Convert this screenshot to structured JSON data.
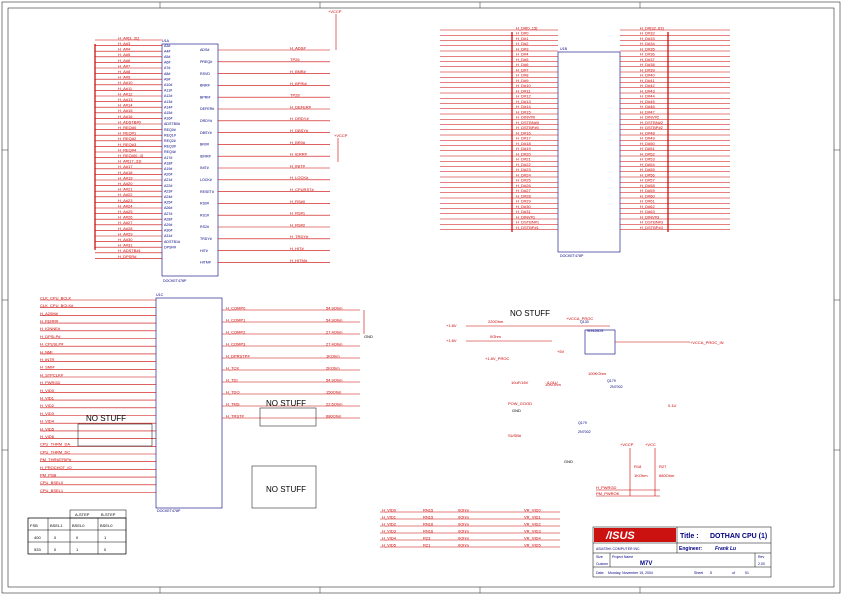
{
  "title_block": {
    "title_label": "Title :",
    "title": "DOTHAN CPU (1)",
    "company": "ASUSTeK COMPUTER INC.",
    "engineer_label": "Engineer:",
    "engineer": "Frank Lu",
    "project_label": "Project Name",
    "project": "M7V",
    "size_label": "Size",
    "size": "Custom",
    "rev_label": "Rev",
    "rev": "2.00",
    "date_label": "Date:",
    "date": "Monday, November 15, 2004",
    "sheet_label": "Sheet",
    "sheet": "5",
    "of_label": "of",
    "sheet_total": "51",
    "logo_text": "/ISUS"
  },
  "rails": {
    "vccp": "+VCCP",
    "vcca_proc": "+VCCA_PROC",
    "v1_8": "+1.8V",
    "v5": "+5V",
    "vcc": "+VCC",
    "gnd": "GND",
    "vcca_proc_in": "+VCCA_PROC_IN"
  },
  "annotations": {
    "no_stuff_1": "NO STUFF",
    "no_stuff_2": "NO STUFF",
    "no_stuff_3": "NO STUFF",
    "no_stuff_4": "NO STUFF"
  },
  "u1a": {
    "ref": "U1A",
    "part": "DOCKET478P",
    "left_nets": [
      "H_A#[3..31]",
      "H_A#3",
      "H_A#4",
      "H_A#5",
      "H_A#6",
      "H_A#7",
      "H_A#8",
      "H_A#9",
      "H_A#10",
      "H_A#11",
      "H_A#12",
      "H_A#13",
      "H_A#14",
      "H_A#15",
      "H_A#16",
      "H_ADSTB#0",
      "H_REQ#0",
      "H_REQ#1",
      "H_REQ#2",
      "H_REQ#3",
      "H_REQ#4",
      "H_REQ#[0..4]",
      "H_A#[17..31]",
      "H_A#17",
      "H_A#18",
      "H_A#19",
      "H_A#20",
      "H_A#21",
      "H_A#22",
      "H_A#23",
      "H_A#24",
      "H_A#25",
      "H_A#26",
      "H_A#27",
      "H_A#28",
      "H_A#29",
      "H_A#30",
      "H_A#31",
      "H_ADSTB#1",
      "H_DPSR#"
    ],
    "right_nets": [
      "H_ADS#",
      "TP26",
      "H_BNR#",
      "H_BPRI#",
      "TP28",
      "H_DEFER#",
      "H_DRDY#",
      "H_DBSY#",
      "H_BR0#",
      "H_IERR#",
      "H_INIT#",
      "H_LOCK#",
      "H_CPURST#",
      "H_RS#0",
      "H_RS#1",
      "H_RS#2",
      "H_TRDY#",
      "H_HIT#",
      "H_HITM#"
    ],
    "pin_labels": [
      "A3#",
      "A4#",
      "A5#",
      "A6#",
      "A7#",
      "A8#",
      "A9#",
      "A10#",
      "A11#",
      "A12#",
      "A13#",
      "A14#",
      "A15#",
      "A16#",
      "ADSTB0#",
      "REQ0#",
      "REQ1#",
      "REQ2#",
      "REQ3#",
      "REQ4#",
      "A17#",
      "A18#",
      "A19#",
      "A20#",
      "A21#",
      "A22#",
      "A23#",
      "A24#",
      "A25#",
      "A26#",
      "A27#",
      "A28#",
      "A29#",
      "A30#",
      "A31#",
      "ADSTB1#",
      "DPSR#"
    ],
    "right_pins": [
      "ADS#",
      "PREQ#",
      "RSVD",
      "BNR#",
      "BPRI#",
      "DEFER#",
      "DRDY#",
      "DBSY#",
      "BR0#",
      "IERR#",
      "INIT#",
      "LOCK#",
      "RESET#",
      "RS0#",
      "RS1#",
      "RS2#",
      "TRDY#",
      "HIT#",
      "HITM#"
    ]
  },
  "u1b": {
    "ref": "U1B",
    "part": "DOCKET478P",
    "left_nets": [
      "H_D#[0..15]",
      "H_D#0",
      "H_D#1",
      "H_D#2",
      "H_D#3",
      "H_D#4",
      "H_D#5",
      "H_D#6",
      "H_D#7",
      "H_D#8",
      "H_D#9",
      "H_D#10",
      "H_D#11",
      "H_D#12",
      "H_D#13",
      "H_D#14",
      "H_D#15",
      "H_DINV#0",
      "H_DSTBN#0",
      "H_DSTBP#0",
      "H_D#16",
      "H_D#17",
      "H_D#18",
      "H_D#19",
      "H_D#20",
      "H_D#21",
      "H_D#22",
      "H_D#23",
      "H_D#24",
      "H_D#25",
      "H_D#26",
      "H_D#27",
      "H_D#28",
      "H_D#29",
      "H_D#30",
      "H_D#31",
      "H_DINV#1",
      "H_DSTBN#1",
      "H_DSTBP#1"
    ],
    "right_nets": [
      "H_D#[32..63]",
      "H_D#32",
      "H_D#33",
      "H_D#34",
      "H_D#35",
      "H_D#36",
      "H_D#37",
      "H_D#38",
      "H_D#39",
      "H_D#40",
      "H_D#41",
      "H_D#42",
      "H_D#43",
      "H_D#44",
      "H_D#45",
      "H_D#46",
      "H_D#47",
      "H_DINV#2",
      "H_DSTBN#2",
      "H_DSTBP#2",
      "H_D#48",
      "H_D#49",
      "H_D#50",
      "H_D#51",
      "H_D#52",
      "H_D#53",
      "H_D#54",
      "H_D#55",
      "H_D#56",
      "H_D#57",
      "H_D#58",
      "H_D#59",
      "H_D#60",
      "H_D#61",
      "H_D#62",
      "H_D#63",
      "H_DINV#3",
      "H_DSTBN#3",
      "H_DSTBP#3"
    ]
  },
  "u1c": {
    "ref": "U1C",
    "part": "DOCKET478P",
    "left_nets": [
      "CLK_CPU_BCLK",
      "CLK_CPU_BCLK#",
      "H_A20M#",
      "H_FERR#",
      "H_IGNNE#",
      "H_DPSLP#",
      "H_CPUSLP#",
      "H_NMI",
      "H_INTR",
      "H_SMI#",
      "H_STPCLK#",
      "H_PWRGD",
      "H_VID0",
      "H_VID1",
      "H_VID2",
      "H_VID3",
      "H_VID4",
      "H_VID5",
      "H_VID6",
      "CPU_THRM_DA",
      "CPU_THRM_DC",
      "PM_THRMTRIP#",
      "H_PROCHOT_IO",
      "PM_PSB",
      "CPU_BSEL0",
      "CPU_BSEL1"
    ],
    "right_nets": [
      "H_COMP0",
      "H_COMP1",
      "H_COMP2",
      "H_COMP3",
      "H_DPRSTP#",
      "H_TCK",
      "H_TDI",
      "H_TDO",
      "H_TMS",
      "H_TRST#"
    ],
    "resistor_values": [
      "54.9Ohm",
      "54.9Ohm",
      "27.4Ohm",
      "27.4Ohm",
      "1KOhm",
      "2KOhm",
      "54.9Ohm",
      "150Ohm",
      "22.6Ohm",
      "680Ohm",
      "1KOhm",
      "1KOhm",
      "56Ohm",
      "0Ohm"
    ]
  },
  "regulator": {
    "ic_ref": "U52",
    "ic_part": "SI9426DS",
    "q1_ref": "Q130",
    "q2_ref": "Q179",
    "q2_part": "2N7002",
    "c1": "10uF/16V",
    "c2": "0.01U",
    "c3": "0.1U",
    "r1": "220Ohm",
    "r2": "0Ohm",
    "r3": "100KOhm",
    "r4": "10KOhm",
    "r_pg": "1KOhm",
    "net_in": "+1.8V_PROC",
    "net_pgd": "POW_GOOD",
    "net_sus": "SUSB#"
  },
  "vid_bus": {
    "left": [
      "H_VID0",
      "H_VID1",
      "H_VID2",
      "H_VID3",
      "H_VID4",
      "H_VID5"
    ],
    "right": [
      "VR_VID0",
      "VR_VID1",
      "VR_VID2",
      "VR_VID3",
      "VR_VID4",
      "VR_VID5"
    ],
    "resistors": [
      "RN15",
      "RN15",
      "RN16",
      "RN16",
      "R23",
      "R21"
    ],
    "values": [
      "0Ohm",
      "0Ohm",
      "0Ohm",
      "0Ohm",
      "0Ohm",
      "0Ohm"
    ]
  },
  "pwr_good": {
    "net_out": "H_PWRGD",
    "net_in": "PM_PWROK",
    "r_ref1": "R18",
    "r_val1": "1KOhm",
    "r_ref2": "R27",
    "r_val2": "680Ohm",
    "rail1": "+VCCP",
    "rail2": "+VCC"
  },
  "bsel_table": {
    "header_a": "A-STEP",
    "header_b": "B-STEP",
    "cols": [
      "FSB",
      "BSEL1",
      "BSEL0",
      "BSEL0"
    ],
    "rows": [
      [
        "400",
        "0",
        "0",
        "1"
      ],
      [
        "533",
        "0",
        "1",
        "0"
      ]
    ]
  }
}
